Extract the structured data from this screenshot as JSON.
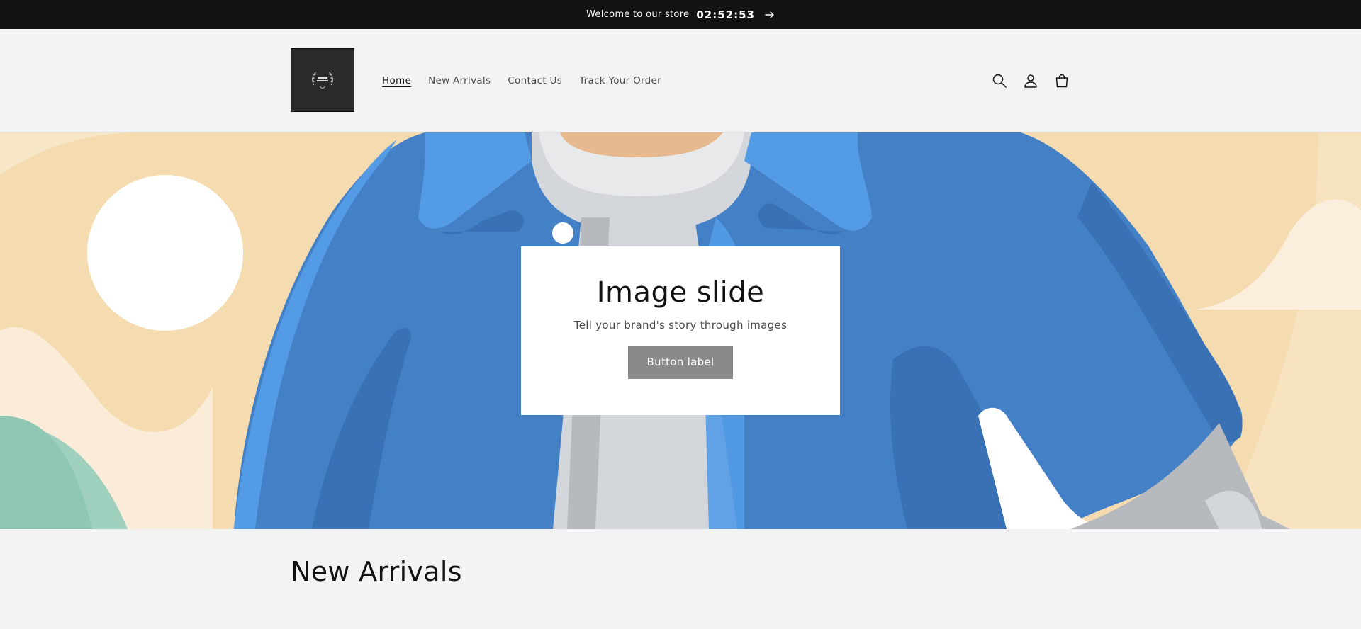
{
  "announcement": {
    "text": "Welcome to our store",
    "timer": "02:52:53",
    "arrow_icon": "arrow-right-icon"
  },
  "header": {
    "logo_alt": "store-logo",
    "nav": [
      {
        "label": "Home",
        "active": true
      },
      {
        "label": "New Arrivals",
        "active": false
      },
      {
        "label": "Contact Us",
        "active": false
      },
      {
        "label": "Track Your Order",
        "active": false
      }
    ],
    "icons": [
      "search-icon",
      "account-icon",
      "cart-icon"
    ]
  },
  "hero": {
    "title": "Image slide",
    "subtitle": "Tell your brand's story through images",
    "button_label": "Button label"
  },
  "sections": {
    "new_arrivals_title": "New Arrivals"
  },
  "colors": {
    "announcement_bg": "#121212",
    "page_bg": "#f3f3f3",
    "hero_bg": "#f5dcb0",
    "jacket_blue": "#4480c6",
    "button_bg": "#8a8a8a"
  }
}
